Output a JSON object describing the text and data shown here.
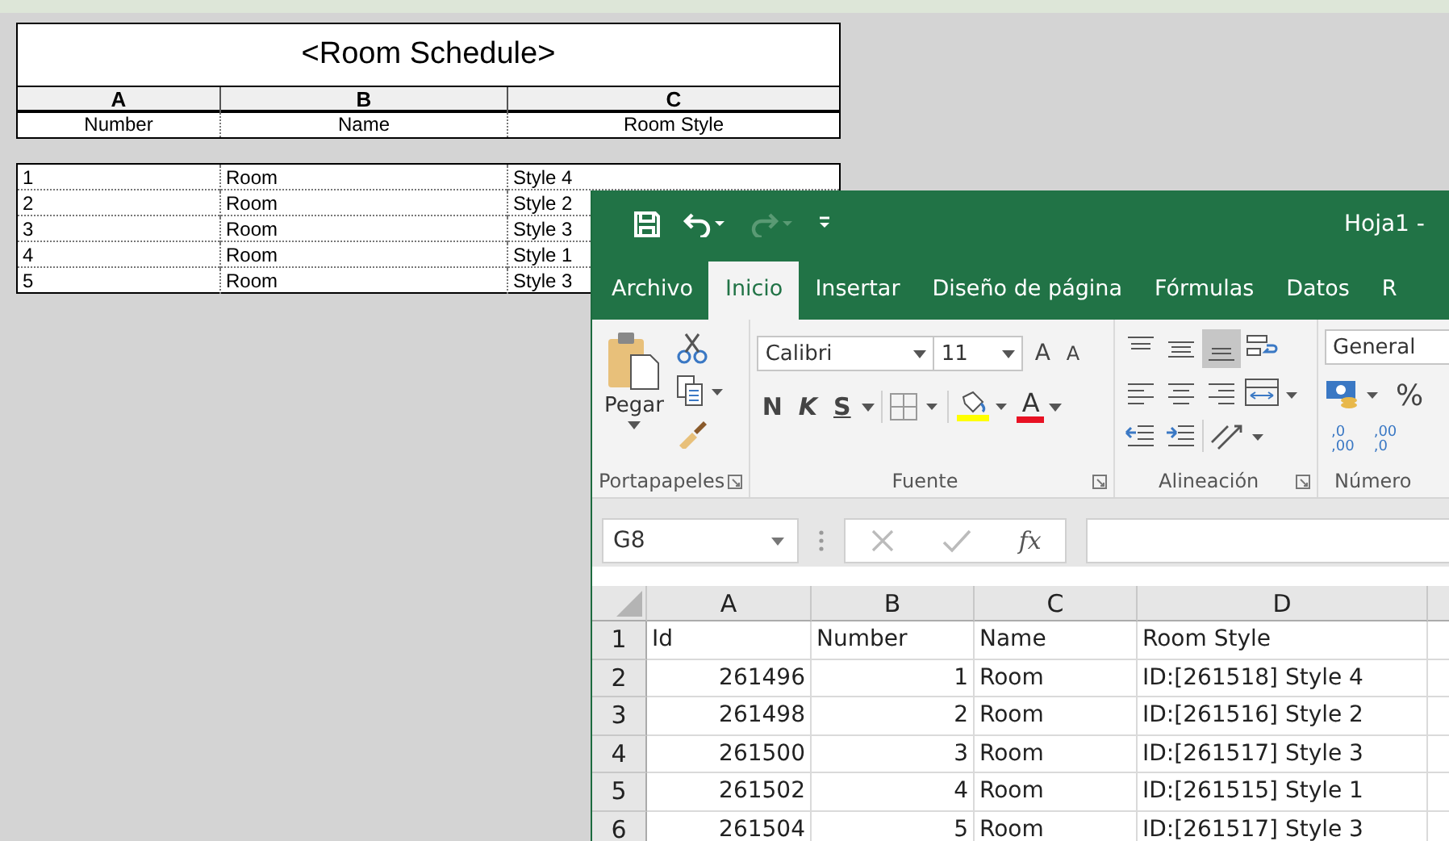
{
  "schedule": {
    "title": "<Room Schedule>",
    "column_letters": [
      "A",
      "B",
      "C"
    ],
    "headers": [
      "Number",
      "Name",
      "Room Style"
    ],
    "rows": [
      [
        "1",
        "Room",
        "Style 4"
      ],
      [
        "2",
        "Room",
        "Style 2"
      ],
      [
        "3",
        "Room",
        "Style 3"
      ],
      [
        "4",
        "Room",
        "Style 1"
      ],
      [
        "5",
        "Room",
        "Style 3"
      ]
    ]
  },
  "excel": {
    "title": "Hoja1 -",
    "quick_access": [
      {
        "kind": "save",
        "disabled": false
      },
      {
        "kind": "undo",
        "disabled": false
      },
      {
        "kind": "redo",
        "disabled": true
      },
      {
        "kind": "customize",
        "disabled": false
      }
    ],
    "tabs": [
      {
        "label": "Archivo",
        "selected": false
      },
      {
        "label": "Inicio",
        "selected": true
      },
      {
        "label": "Insertar",
        "selected": false
      },
      {
        "label": "Diseño de página",
        "selected": false
      },
      {
        "label": "Fórmulas",
        "selected": false
      },
      {
        "label": "Datos",
        "selected": false
      },
      {
        "label": "R",
        "selected": false
      }
    ],
    "ribbon": {
      "paste_label": "Pegar",
      "font_name": "Calibri",
      "font_size": "11",
      "grow_font": "A",
      "shrink_font": "A",
      "bold": "N",
      "italic": "K",
      "underline": "S",
      "font_color": "A",
      "number_format": "General",
      "percent": "%",
      "decimal_increase": [
        ",0",
        ",00"
      ],
      "decimal_decrease": [
        ",00",
        ",0"
      ],
      "vertical_align": [
        {
          "kind": "top",
          "selected": false
        },
        {
          "kind": "middle",
          "selected": false
        },
        {
          "kind": "bottom",
          "selected": true
        }
      ],
      "groups": [
        "Portapapeles",
        "Fuente",
        "Alineación",
        "Número"
      ]
    },
    "name_box": "G8",
    "function_symbol": "fx",
    "columns": [
      "A",
      "B",
      "C",
      "D"
    ],
    "rows": [
      {
        "number": "1",
        "cells": [
          {
            "text": "Id",
            "kind": "text"
          },
          {
            "text": "Number",
            "kind": "text"
          },
          {
            "text": "Name",
            "kind": "text"
          },
          {
            "text": "Room Style",
            "kind": "text"
          }
        ]
      },
      {
        "number": "2",
        "cells": [
          {
            "text": "261496",
            "kind": "number"
          },
          {
            "text": "1",
            "kind": "number"
          },
          {
            "text": "Room",
            "kind": "text"
          },
          {
            "text": "ID:[261518] Style 4",
            "kind": "text"
          }
        ]
      },
      {
        "number": "3",
        "cells": [
          {
            "text": "261498",
            "kind": "number"
          },
          {
            "text": "2",
            "kind": "number"
          },
          {
            "text": "Room",
            "kind": "text"
          },
          {
            "text": "ID:[261516] Style 2",
            "kind": "text"
          }
        ]
      },
      {
        "number": "4",
        "cells": [
          {
            "text": "261500",
            "kind": "number"
          },
          {
            "text": "3",
            "kind": "number"
          },
          {
            "text": "Room",
            "kind": "text"
          },
          {
            "text": "ID:[261517] Style 3",
            "kind": "text"
          }
        ]
      },
      {
        "number": "5",
        "cells": [
          {
            "text": "261502",
            "kind": "number"
          },
          {
            "text": "4",
            "kind": "number"
          },
          {
            "text": "Room",
            "kind": "text"
          },
          {
            "text": "ID:[261515] Style 1",
            "kind": "text"
          }
        ]
      },
      {
        "number": "6",
        "cells": [
          {
            "text": "261504",
            "kind": "number"
          },
          {
            "text": "5",
            "kind": "number"
          },
          {
            "text": "Room",
            "kind": "text"
          },
          {
            "text": "ID:[261517] Style 3",
            "kind": "text"
          }
        ]
      }
    ]
  }
}
